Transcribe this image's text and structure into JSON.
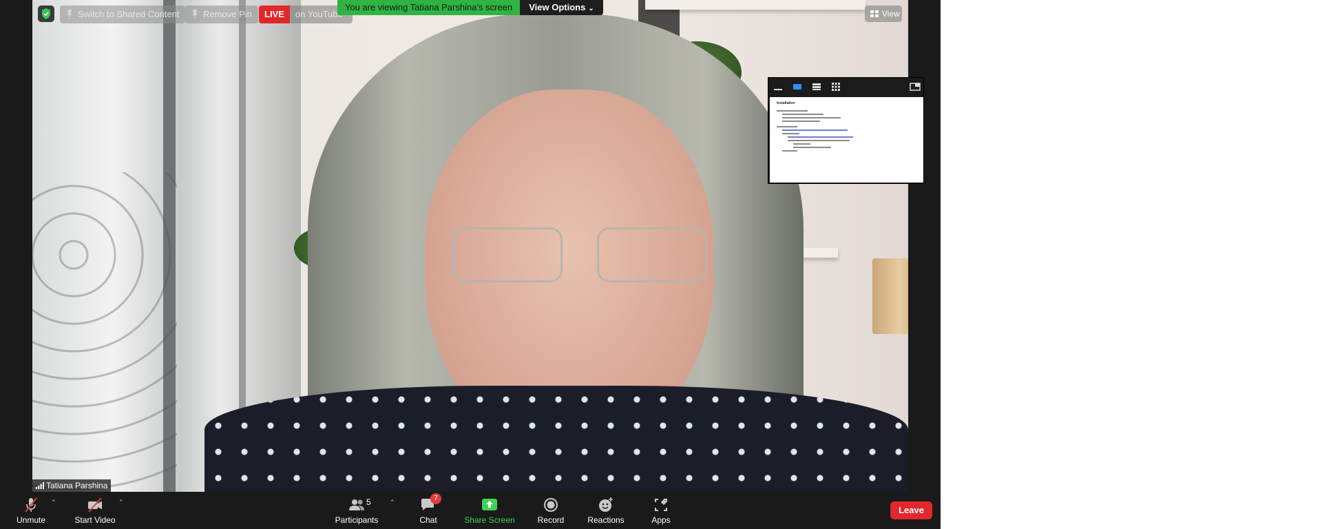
{
  "top_bar": {
    "switch_label": "Switch to Shared Content",
    "remove_pin_label": "Remove Pin",
    "live_badge": "LIVE",
    "live_text": "on YouTube",
    "viewing_banner": "You are viewing Tatiana Parshina's screen",
    "view_options_label": "View Options",
    "view_label": "View"
  },
  "participant": {
    "name": "Tatiana Parshina"
  },
  "shared_preview": {
    "title": "Installation"
  },
  "toolbar": {
    "unmute_label": "Unmute",
    "start_video_label": "Start Video",
    "participants_label": "Participants",
    "participants_count": "5",
    "chat_label": "Chat",
    "chat_badge": "7",
    "share_screen_label": "Share Screen",
    "record_label": "Record",
    "reactions_label": "Reactions",
    "apps_label": "Apps",
    "leave_label": "Leave"
  },
  "colors": {
    "share_green": "#3fd25a",
    "banner_green": "#2fb343",
    "leave_red": "#e0282c",
    "live_red": "#e02828",
    "badge_red": "#e23c3c",
    "toolbar_bg": "#1a1a1a"
  }
}
